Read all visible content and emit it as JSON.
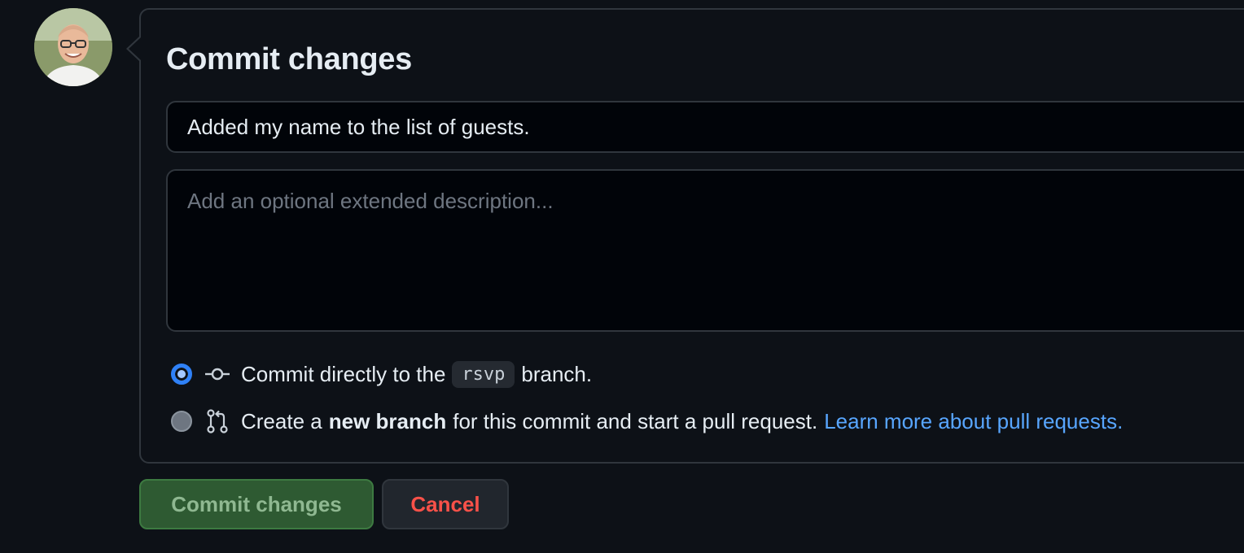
{
  "form": {
    "title": "Commit changes",
    "summary_value": "Added my name to the list of guests.",
    "description_placeholder": "Add an optional extended description..."
  },
  "options": {
    "direct": {
      "prefix": "Commit directly to the",
      "branch": "rsvp",
      "suffix": "branch.",
      "selected": true,
      "icon": "git-commit-icon"
    },
    "new_branch": {
      "prefix": "Create a",
      "bold": "new branch",
      "suffix": "for this commit and start a pull request.",
      "link": "Learn more about pull requests.",
      "selected": false,
      "icon": "git-pull-request-icon"
    }
  },
  "buttons": {
    "commit_label": "Commit changes",
    "cancel_label": "Cancel"
  },
  "colors": {
    "background": "#0d1117",
    "primary_button": "#2e5a32",
    "danger_text": "#f85149",
    "link": "#58a6ff"
  }
}
